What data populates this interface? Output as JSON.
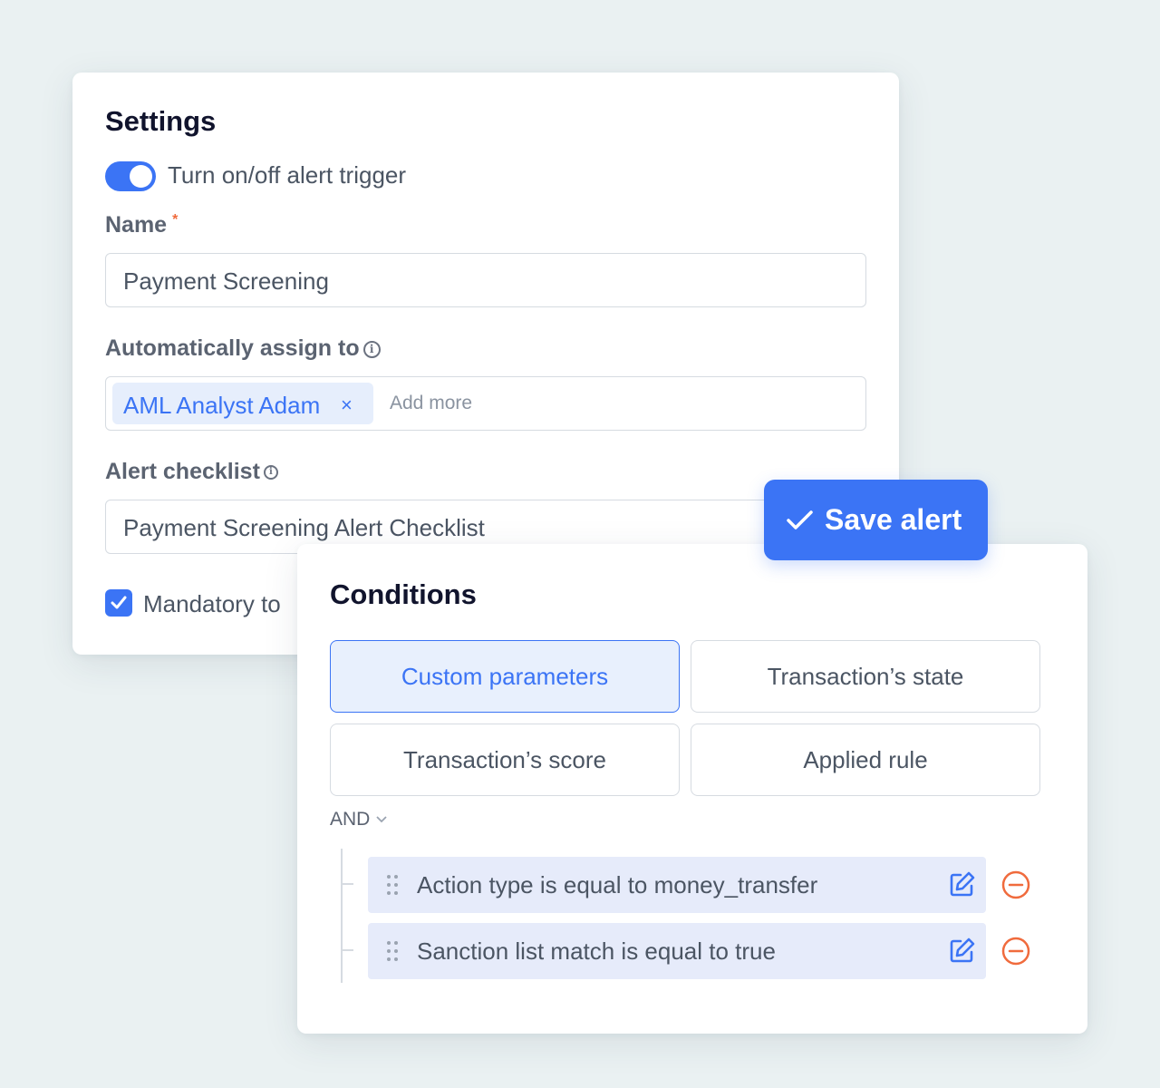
{
  "settings": {
    "title": "Settings",
    "toggle_label": "Turn on/off alert trigger",
    "name_label": "Name",
    "name_required": "*",
    "name_value": "Payment Screening",
    "assign_label": "Automatically assign to",
    "assign_chip": "AML Analyst Adam",
    "assign_chip_remove": "×",
    "assign_placeholder": "Add more",
    "checklist_label": "Alert checklist",
    "checklist_value": "Payment Screening Alert Checklist",
    "mandatory_label": "Mandatory to"
  },
  "save_button": {
    "label": "Save alert"
  },
  "conditions": {
    "title": "Conditions",
    "tiles": [
      {
        "label": "Custom parameters",
        "active": true
      },
      {
        "label": "Transaction’s state",
        "active": false
      },
      {
        "label": "Transaction’s score",
        "active": false
      },
      {
        "label": "Applied rule",
        "active": false
      }
    ],
    "operator": "AND",
    "rules": [
      {
        "text": "Action type is equal to money_transfer"
      },
      {
        "text": "Sanction list match is equal to true"
      }
    ]
  },
  "colors": {
    "accent": "#3b74f5",
    "remove": "#f06b3d",
    "background": "#eaf1f2"
  }
}
